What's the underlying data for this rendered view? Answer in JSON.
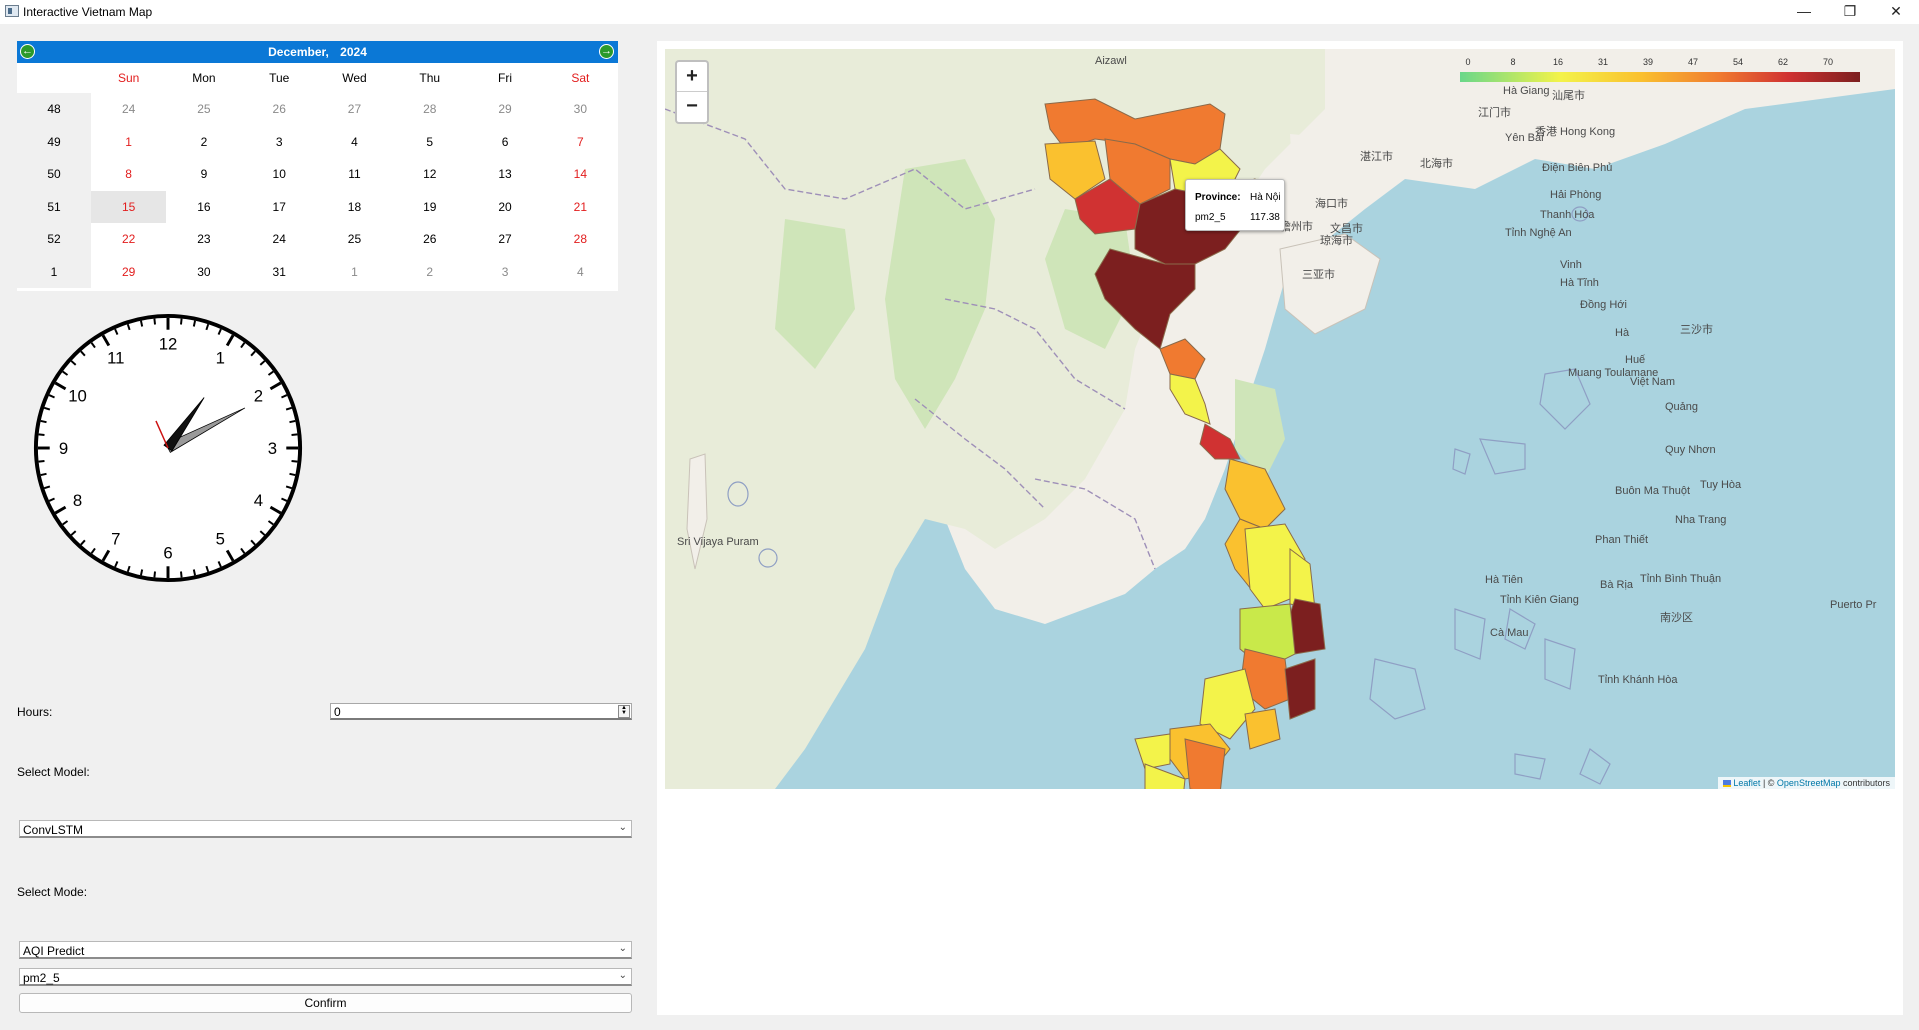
{
  "window": {
    "title": "Interactive Vietnam Map"
  },
  "calendar": {
    "month": "December,",
    "year": "2024",
    "headers": [
      "Sun",
      "Mon",
      "Tue",
      "Wed",
      "Thu",
      "Fri",
      "Sat"
    ],
    "weeks": [
      {
        "num": "48",
        "days": [
          "24",
          "25",
          "26",
          "27",
          "28",
          "29",
          "30"
        ]
      },
      {
        "num": "49",
        "days": [
          "1",
          "2",
          "3",
          "4",
          "5",
          "6",
          "7"
        ]
      },
      {
        "num": "50",
        "days": [
          "8",
          "9",
          "10",
          "11",
          "12",
          "13",
          "14"
        ]
      },
      {
        "num": "51",
        "days": [
          "15",
          "16",
          "17",
          "18",
          "19",
          "20",
          "21"
        ]
      },
      {
        "num": "52",
        "days": [
          "22",
          "23",
          "24",
          "25",
          "26",
          "27",
          "28"
        ]
      },
      {
        "num": "1",
        "days": [
          "29",
          "30",
          "31",
          "1",
          "2",
          "3",
          "4"
        ]
      }
    ],
    "selected": "15"
  },
  "clock": {
    "numerals": [
      "12",
      "1",
      "2",
      "3",
      "4",
      "5",
      "6",
      "7",
      "8",
      "9",
      "10",
      "11"
    ],
    "time": {
      "hour": 2,
      "minute": 5,
      "second": 56
    }
  },
  "form": {
    "hours_label": "Hours:",
    "hours_value": "0",
    "model_label": "Select Model:",
    "model_value": "ConvLSTM",
    "mode_label": "Select Mode:",
    "mode_value": "AQI Predict",
    "pollutant_value": "pm2_5",
    "confirm_label": "Confirm"
  },
  "map": {
    "zoom_in": "+",
    "zoom_out": "−",
    "legend_ticks": [
      "0",
      "8",
      "16",
      "31",
      "39",
      "47",
      "54",
      "62",
      "70"
    ],
    "tooltip": {
      "province_key": "Province:",
      "province_value": "Hà Nội",
      "metric_key": "pm2_5",
      "metric_value": "117.38"
    },
    "attribution": {
      "leaflet": "Leaflet",
      "sep": " | © ",
      "osm": "OpenStreetMap",
      "rest": " contributors"
    },
    "labels": [
      "Aizawl",
      "Hà Giang",
      "Yên Bái",
      "Điện Biên Phủ",
      "Hải Phòng",
      "Thanh Hóa",
      "Tỉnh Nghệ An",
      "Vinh",
      "Hà Tĩnh",
      "Đồng Hới",
      "Hà",
      "Huế",
      "Việt Nam",
      "Quảng",
      "Quy Nhơn",
      "Tuy Hòa",
      "Buôn Ma Thuột",
      "Nha Trang",
      "Phan Thiết",
      "Bà Rịa",
      "Tỉnh Bình Thuận",
      "Hà Tiên",
      "Tỉnh Kiên Giang",
      "Cà Mau",
      "Muang Toulamane",
      "Sri Vijaya Puram",
      "Puerto Pr",
      "海口市",
      "北海市",
      "湛江市",
      "三亚市",
      "儋州市",
      "文昌市",
      "琼海市",
      "江门市",
      "香港 Hong Kong",
      "汕尾市",
      "三沙市",
      "南沙区",
      "Tỉnh Khánh Hòa"
    ],
    "colors": {
      "c0": "#f3f34a",
      "c1": "#fac12f",
      "c2": "#f07a30",
      "c3": "#d03232",
      "c4": "#7c1f1f",
      "c5": "#c9e94a"
    }
  }
}
